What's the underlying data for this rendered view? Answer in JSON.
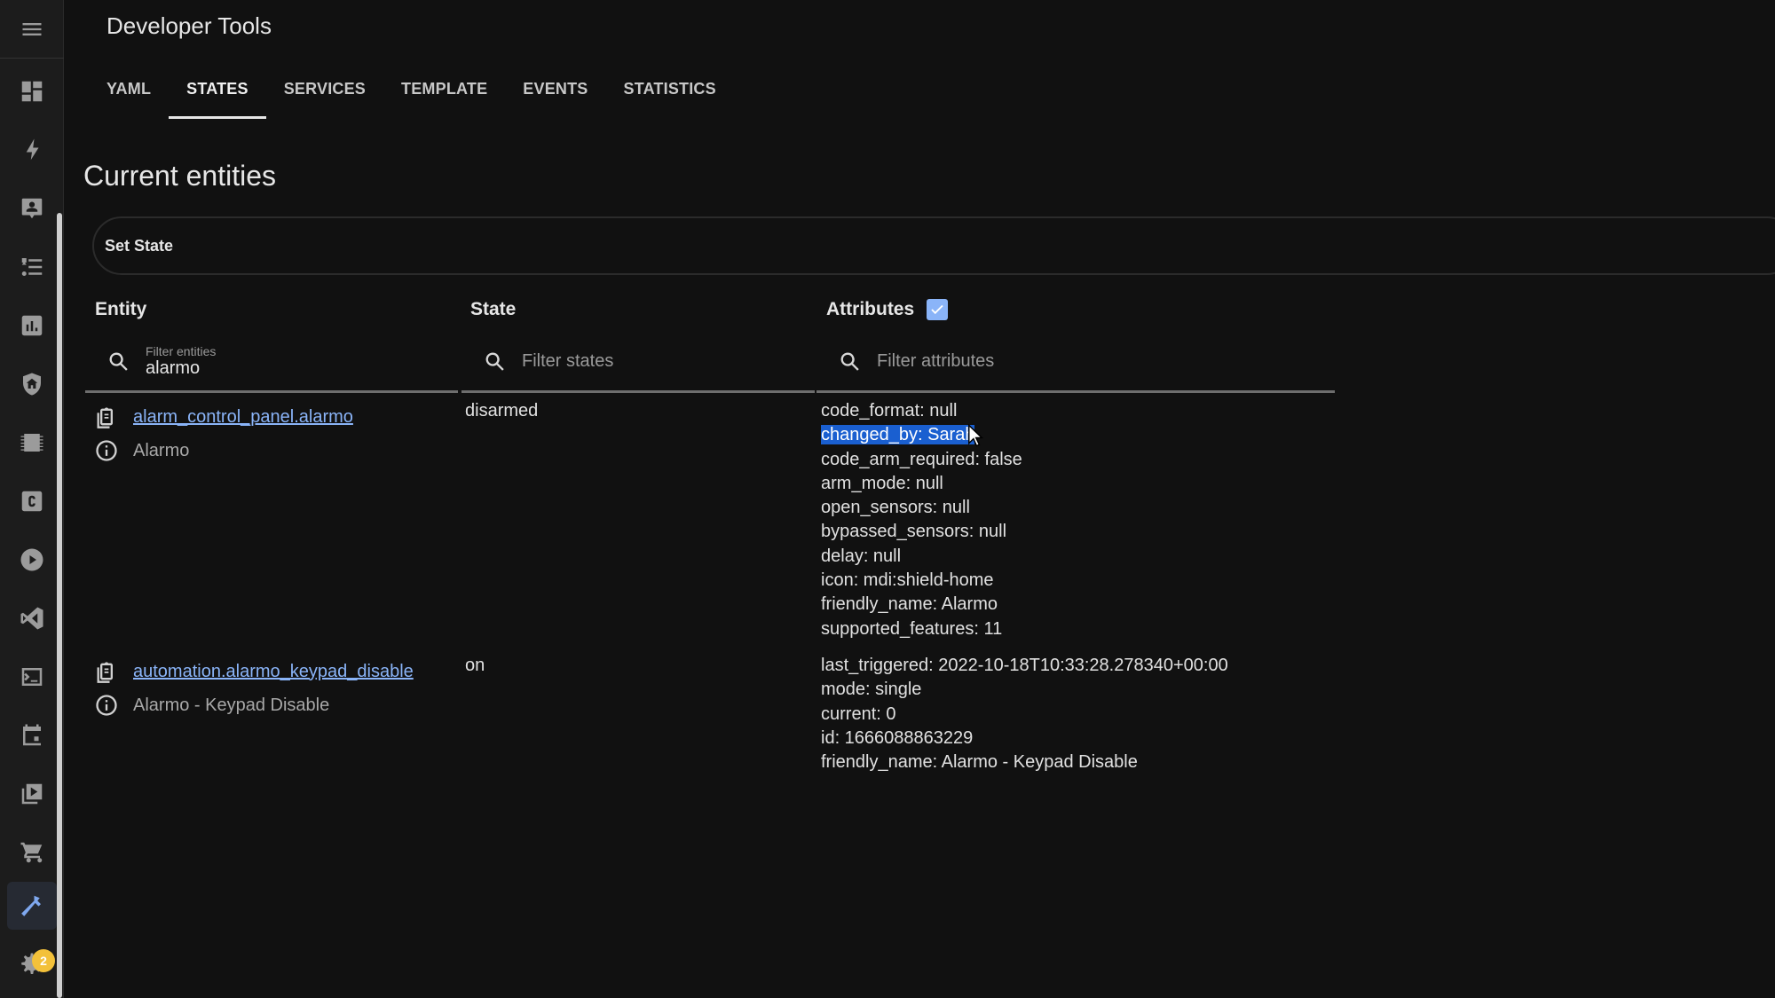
{
  "app": {
    "title": "Developer Tools"
  },
  "tabs": [
    {
      "label": "YAML",
      "active": false
    },
    {
      "label": "STATES",
      "active": true
    },
    {
      "label": "SERVICES",
      "active": false
    },
    {
      "label": "TEMPLATE",
      "active": false
    },
    {
      "label": "EVENTS",
      "active": false
    },
    {
      "label": "STATISTICS",
      "active": false
    }
  ],
  "sidebar": {
    "items": [
      {
        "icon": "view-dashboard-icon"
      },
      {
        "icon": "lightning-bolt-icon"
      },
      {
        "icon": "account-box-icon"
      },
      {
        "icon": "format-list-icon"
      },
      {
        "icon": "chart-box-icon"
      },
      {
        "icon": "shield-home-icon"
      },
      {
        "icon": "chip-icon"
      },
      {
        "icon": "esphome-icon"
      },
      {
        "icon": "play-circle-icon"
      },
      {
        "icon": "vscode-icon"
      },
      {
        "icon": "console-icon"
      },
      {
        "icon": "calendar-icon"
      },
      {
        "icon": "play-box-multiple-icon"
      },
      {
        "icon": "cart-icon"
      },
      {
        "icon": "hammer-icon",
        "active": true
      },
      {
        "icon": "cog-icon"
      }
    ],
    "notification_count": "2",
    "accent_color": "#8ab4f8",
    "badge_color": "#f3c13a"
  },
  "main": {
    "section_title": "Current entities",
    "set_state_label": "Set State",
    "columns": {
      "entity": "Entity",
      "state": "State",
      "attributes": "Attributes",
      "attributes_checked": true
    },
    "filters": {
      "entity_label": "Filter entities",
      "entity_value": "alarmo",
      "state_placeholder": "Filter states",
      "attributes_placeholder": "Filter attributes"
    },
    "rows": [
      {
        "entity_id": "alarm_control_panel.alarmo",
        "friendly_name": "Alarmo",
        "state": "disarmed",
        "attributes": [
          "code_format: null",
          "changed_by: Sarah",
          "code_arm_required: false",
          "arm_mode: null",
          "open_sensors: null",
          "bypassed_sensors: null",
          "delay: null",
          "icon: mdi:shield-home",
          "friendly_name: Alarmo",
          "supported_features: 11"
        ],
        "highlighted_attribute_index": 1
      },
      {
        "entity_id": "automation.alarmo_keypad_disable",
        "friendly_name": "Alarmo - Keypad Disable",
        "state": "on",
        "attributes": [
          "last_triggered: 2022-10-18T10:33:28.278340+00:00",
          "mode: single",
          "current: 0",
          "id: 1666088863229",
          "friendly_name: Alarmo - Keypad Disable"
        ]
      }
    ]
  }
}
